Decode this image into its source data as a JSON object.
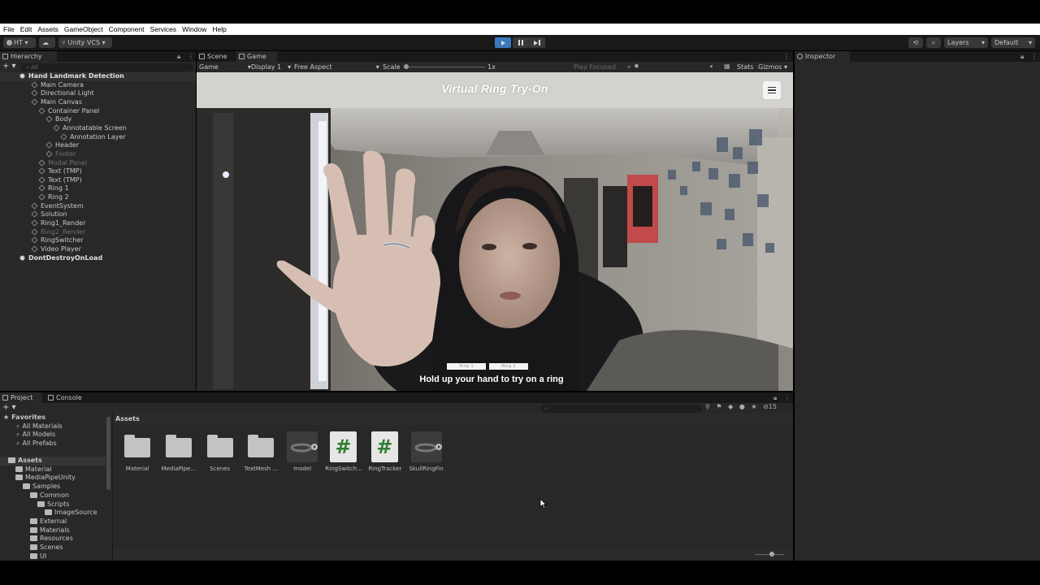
{
  "menu": [
    "File",
    "Edit",
    "Assets",
    "GameObject",
    "Component",
    "Services",
    "Window",
    "Help"
  ],
  "toolbar": {
    "account": "HT",
    "vcs": "Unity VCS",
    "layers": "Layers",
    "layout": "Default"
  },
  "hierarchy": {
    "tab": "Hierarchy",
    "search_placeholder": "All",
    "items": [
      {
        "label": "Hand Landmark Detection",
        "depth": 0,
        "style": "scene"
      },
      {
        "label": "Main Camera",
        "depth": 1
      },
      {
        "label": "Directional Light",
        "depth": 1
      },
      {
        "label": "Main Canvas",
        "depth": 1
      },
      {
        "label": "Container Panel",
        "depth": 2
      },
      {
        "label": "Body",
        "depth": 3
      },
      {
        "label": "Annotatable Screen",
        "depth": 4
      },
      {
        "label": "Annotation Layer",
        "depth": 5
      },
      {
        "label": "Header",
        "depth": 3
      },
      {
        "label": "Footer",
        "depth": 3,
        "style": "dim"
      },
      {
        "label": "Modal Panel",
        "depth": 2,
        "style": "dim"
      },
      {
        "label": "Text (TMP)",
        "depth": 2
      },
      {
        "label": "Text (TMP)",
        "depth": 2
      },
      {
        "label": "Ring 1",
        "depth": 2
      },
      {
        "label": "Ring 2",
        "depth": 2
      },
      {
        "label": "EventSystem",
        "depth": 1
      },
      {
        "label": "Solution",
        "depth": 1
      },
      {
        "label": "Ring1_Render",
        "depth": 1
      },
      {
        "label": "Ring2_Render",
        "depth": 1,
        "style": "dim"
      },
      {
        "label": "RingSwitcher",
        "depth": 1
      },
      {
        "label": "Video Player",
        "depth": 1
      },
      {
        "label": "DontDestroyOnLoad",
        "depth": 0,
        "style": "scene"
      }
    ]
  },
  "scene_tabs": {
    "scene": "Scene",
    "game": "Game"
  },
  "gamebar": {
    "display_mode": "Game",
    "display": "Display 1",
    "aspect": "Free Aspect",
    "scale_label": "Scale",
    "scale_value": "1x",
    "play_focused": "Play Focused",
    "stats": "Stats",
    "gizmos": "Gizmos"
  },
  "game": {
    "title": "Virtual Ring Try-On",
    "ring1": "Ring 1",
    "ring2": "Ring 2",
    "instruction": "Hold up your hand to try on a ring"
  },
  "inspector": {
    "tab": "Inspector"
  },
  "project": {
    "tab": "Project",
    "console_tab": "Console",
    "hidden_count": "15",
    "favorites": {
      "label": "Favorites",
      "items": [
        "All Materials",
        "All Models",
        "All Prefabs"
      ]
    },
    "tree": [
      {
        "label": "Assets",
        "depth": 0,
        "style": "bold"
      },
      {
        "label": "Material",
        "depth": 1
      },
      {
        "label": "MediaPipeUnity",
        "depth": 1
      },
      {
        "label": "Samples",
        "depth": 2
      },
      {
        "label": "Common",
        "depth": 3
      },
      {
        "label": "Scripts",
        "depth": 4
      },
      {
        "label": "ImageSource",
        "depth": 5
      },
      {
        "label": "External",
        "depth": 3
      },
      {
        "label": "Materials",
        "depth": 3
      },
      {
        "label": "Resources",
        "depth": 3
      },
      {
        "label": "Scenes",
        "depth": 3
      },
      {
        "label": "UI",
        "depth": 3
      }
    ],
    "breadcrumb": "Assets",
    "assets": [
      {
        "label": "Material",
        "kind": "folder"
      },
      {
        "label": "MediaPipe...",
        "kind": "folder"
      },
      {
        "label": "Scenes",
        "kind": "folder"
      },
      {
        "label": "TextMesh ...",
        "kind": "folder"
      },
      {
        "label": "model",
        "kind": "model"
      },
      {
        "label": "RingSwitch...",
        "kind": "script"
      },
      {
        "label": "RingTracker",
        "kind": "script"
      },
      {
        "label": "SkullRingFin",
        "kind": "model"
      }
    ],
    "script_glyph": "#"
  }
}
